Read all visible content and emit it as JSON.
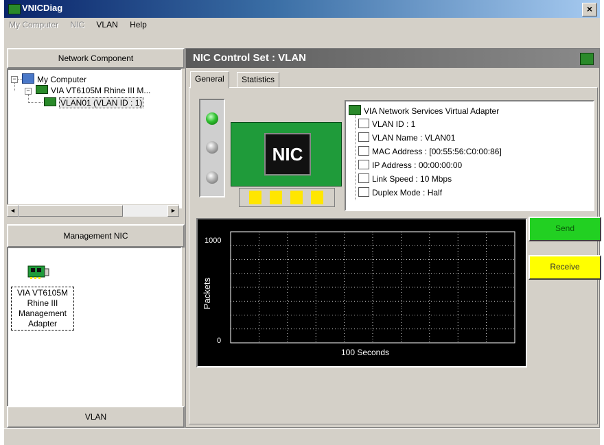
{
  "window": {
    "title": "VNICDiag",
    "close_glyph": "×"
  },
  "menu": {
    "items": [
      {
        "label": "My Computer",
        "enabled": false
      },
      {
        "label": "NIC",
        "enabled": false
      },
      {
        "label": "VLAN",
        "enabled": true
      },
      {
        "label": "Help",
        "enabled": true
      }
    ]
  },
  "left_panel": {
    "header": "Network Component",
    "tree": {
      "root_toggle": "−",
      "root": "My Computer",
      "child_toggle": "−",
      "child": "VIA VT6105M Rhine III M...",
      "leaf": "VLAN01 (VLAN ID : 1)"
    },
    "scroll_left": "◄",
    "scroll_right": "►"
  },
  "management_panel": {
    "header": "Management NIC",
    "adapter_label_lines": [
      "VIA VT6105M",
      "Rhine III",
      "Management",
      "Adapter"
    ]
  },
  "left_footer": "VLAN",
  "control": {
    "title": "NIC Control Set : VLAN",
    "tabs": [
      "General",
      "Statistics"
    ],
    "active_tab": "General",
    "nic_label": "NIC",
    "leds": [
      "on",
      "off",
      "off"
    ],
    "properties": {
      "root": "VIA Network Services Virtual Adapter",
      "items": [
        "VLAN ID : 1",
        "VLAN Name : VLAN01",
        "MAC Address : [00:55:56:C0:00:86]",
        "IP Address : 00:00:00:00",
        "Link Speed : 10 Mbps",
        "Duplex Mode : Half"
      ]
    },
    "send_label": "Send",
    "receive_label": "Receive"
  },
  "chart_data": {
    "type": "line",
    "title": "",
    "xlabel": "100 Seconds",
    "ylabel": "Packets",
    "y_ticks": [
      "1000",
      "0"
    ],
    "ylim": [
      0,
      1000
    ],
    "xlim": [
      0,
      100
    ],
    "grid": true,
    "series": [],
    "colors": {
      "background": "#000000",
      "grid": "#ffffff",
      "text": "#ffffff"
    }
  }
}
